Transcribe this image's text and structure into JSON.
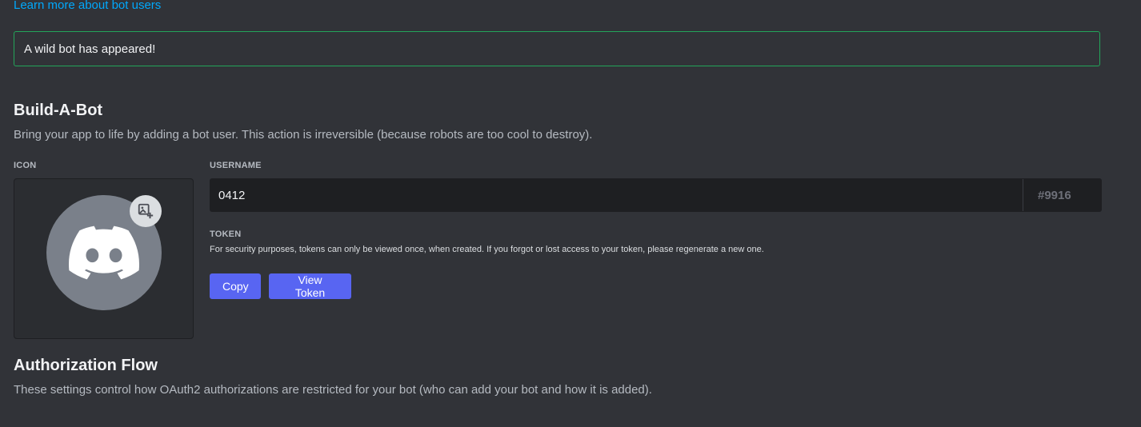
{
  "learn_link": "Learn more about bot users",
  "notice": "A wild bot has appeared!",
  "build_a_bot": {
    "title": "Build-A-Bot",
    "description": "Bring your app to life by adding a bot user. This action is irreversible (because robots are too cool to destroy).",
    "icon_label": "ICON",
    "username_label": "USERNAME",
    "username_value": "0412",
    "discriminator": "#9916",
    "token_label": "TOKEN",
    "token_description": "For security purposes, tokens can only be viewed once, when created. If you forgot or lost access to your token, please regenerate a new one.",
    "copy_button": "Copy",
    "view_token_button": "View Token",
    "avatar_icon": "discord-logo-icon",
    "upload_icon": "add-image-icon"
  },
  "authorization_flow": {
    "title": "Authorization Flow",
    "description": "These settings control how OAuth2 authorizations are restricted for your bot (who can add your bot and how it is added)."
  },
  "colors": {
    "background": "#313338",
    "accent": "#5865f2",
    "success_border": "#23a55a",
    "link": "#00a8fc"
  }
}
